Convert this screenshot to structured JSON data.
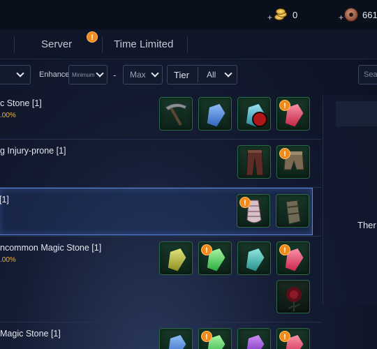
{
  "currency": {
    "gold": {
      "plus": "+",
      "value": "0",
      "icon": "gold-coins-icon"
    },
    "bronze": {
      "plus": "+",
      "value": "661",
      "icon": "bronze-coin-icon"
    }
  },
  "tabs": {
    "server": "Server",
    "server_alert": "!",
    "time_limited": "Time Limited"
  },
  "filters": {
    "enhance_label": "Enhance",
    "enhance_min_placeholder": "Minimum",
    "dash": "-",
    "enhance_max": "Max",
    "tier_label": "Tier",
    "tier_value": "All",
    "search_placeholder": "Sea"
  },
  "rows": [
    {
      "title": "c Stone [1]",
      "pct": ".00%"
    },
    {
      "title": "g Injury-prone [1]",
      "pct": ""
    },
    {
      "title": "[1]",
      "pct": ""
    },
    {
      "title": "ncommon Magic Stone [1]",
      "pct": ".00%"
    },
    {
      "title": "Magic Stone [1]",
      "pct": ""
    }
  ],
  "alert_glyph": "!",
  "right_panel": {
    "text": "Ther"
  },
  "colors": {
    "accent_alert": "#f08a1c",
    "pct_text": "#f2b233",
    "selected_border": "#5c86d9"
  }
}
